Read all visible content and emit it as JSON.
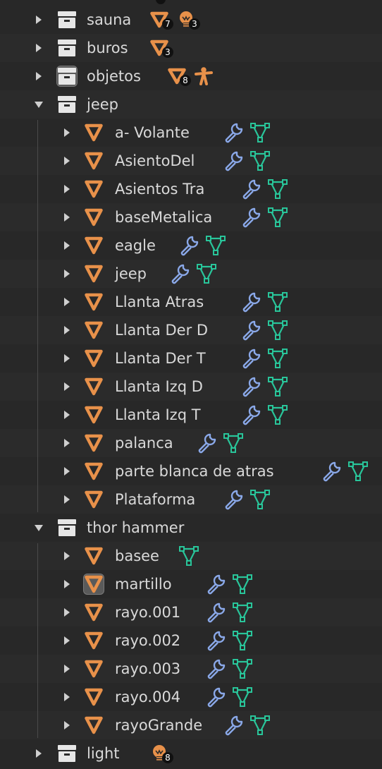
{
  "collections": {
    "sauna": {
      "label": "sauna",
      "badges": [
        {
          "icon": "mesh-data-icon",
          "count": "7"
        },
        {
          "icon": "light-bulb-icon",
          "count": "3"
        }
      ]
    },
    "buros": {
      "label": "buros",
      "badges": [
        {
          "icon": "mesh-data-icon",
          "count": "3"
        }
      ]
    },
    "objetos": {
      "label": "objetos",
      "badges": [
        {
          "icon": "mesh-data-icon",
          "count": "8"
        },
        {
          "icon": "armature-icon",
          "count": ""
        }
      ]
    },
    "jeep": {
      "label": "jeep"
    },
    "thor": {
      "label": "thor hammer"
    },
    "light": {
      "label": "light",
      "badges": [
        {
          "icon": "light-bulb-icon",
          "count": "8"
        }
      ]
    }
  },
  "jeep_children": [
    {
      "label": "a- Volante",
      "modifier": true
    },
    {
      "label": "AsientoDel",
      "modifier": true
    },
    {
      "label": "Asientos Tra",
      "modifier": true
    },
    {
      "label": "baseMetalica",
      "modifier": true
    },
    {
      "label": "eagle",
      "modifier": true
    },
    {
      "label": "jeep",
      "modifier": true
    },
    {
      "label": "Llanta Atras",
      "modifier": true
    },
    {
      "label": "Llanta Der D",
      "modifier": true
    },
    {
      "label": "Llanta Der T",
      "modifier": true
    },
    {
      "label": "Llanta Izq D",
      "modifier": true
    },
    {
      "label": "Llanta Izq T",
      "modifier": true
    },
    {
      "label": "palanca",
      "modifier": true
    },
    {
      "label": "parte blanca de atras",
      "modifier": true
    },
    {
      "label": "Plataforma",
      "modifier": true
    }
  ],
  "thor_children": [
    {
      "label": "basee",
      "modifier": false
    },
    {
      "label": "martillo",
      "modifier": true,
      "active": true
    },
    {
      "label": "rayo.001",
      "modifier": true
    },
    {
      "label": "rayo.002",
      "modifier": true
    },
    {
      "label": "rayo.003",
      "modifier": true
    },
    {
      "label": "rayo.004",
      "modifier": true
    },
    {
      "label": "rayoGrande",
      "modifier": true
    }
  ],
  "colors": {
    "background": "#282828",
    "text": "#d9d9d9",
    "object_orange": "#e8914a",
    "wrench_blue": "#8aa8e8",
    "mesh_green": "#29c59a"
  }
}
